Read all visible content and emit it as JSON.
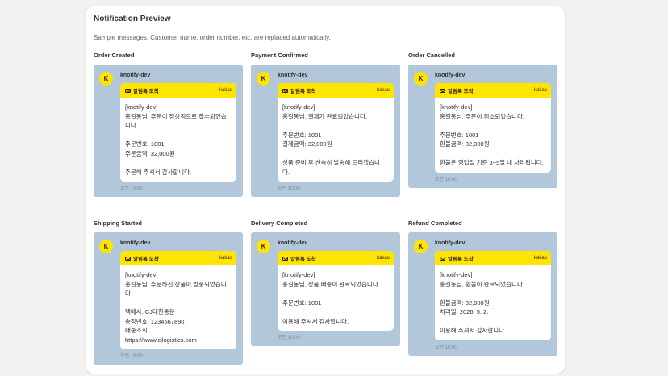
{
  "preview": {
    "title": "Notification Preview",
    "description": "Sample messages. Customer name, order number, etc. are replaced automatically."
  },
  "colors": {
    "chat_bg": "#b2c7da",
    "kakao_yellow": "#fee500"
  },
  "cards": [
    {
      "label": "Order Created",
      "avatar": "K",
      "sender": "knotify-dev",
      "head": "알림톡 도착",
      "brand": "kakao",
      "lines": [
        "[knotify-dev]",
        "홍길동님, 주문이 정상적으로 접수되었습",
        "니다.",
        "",
        "주문번호: 1001",
        "주문금액: 32,000원",
        "",
        "주문해 주셔서 감사합니다."
      ],
      "time": "오전 10:00"
    },
    {
      "label": "Payment Confirmed",
      "avatar": "K",
      "sender": "knotify-dev",
      "head": "알림톡 도착",
      "brand": "kakao",
      "lines": [
        "[knotify-dev]",
        "홍길동님, 결제가 완료되었습니다.",
        "",
        "주문번호: 1001",
        "결제금액: 32,000원",
        "",
        "상품 준비 후 신속히 발송해 드리겠습니",
        "다."
      ],
      "time": "오전 10:00"
    },
    {
      "label": "Order Cancelled",
      "avatar": "K",
      "sender": "knotify-dev",
      "head": "알림톡 도착",
      "brand": "kakao",
      "lines": [
        "[knotify-dev]",
        "홍길동님, 주문이 취소되었습니다.",
        "",
        "주문번호: 1001",
        "환불금액: 32,000원",
        "",
        "환불은 영업일 기준 3~5일 내 처리됩니다."
      ],
      "time": "오전 10:00"
    },
    {
      "label": "Shipping Started",
      "avatar": "K",
      "sender": "knotify-dev",
      "head": "알림톡 도착",
      "brand": "kakao",
      "lines": [
        "[knotify-dev]",
        "홍길동님, 주문하신 상품이 발송되었습니",
        "다.",
        "",
        "택배사: CJ대한통운",
        "송장번호: 1234567890",
        "배송조회:",
        "https://www.cjlogistics.com"
      ],
      "time": "오전 10:00"
    },
    {
      "label": "Delivery Completed",
      "avatar": "K",
      "sender": "knotify-dev",
      "head": "알림톡 도착",
      "brand": "kakao",
      "lines": [
        "[knotify-dev]",
        "홍길동님, 상품 배송이 완료되었습니다.",
        "",
        "주문번호: 1001",
        "",
        "이용해 주셔서 감사합니다."
      ],
      "time": "오전 10:00"
    },
    {
      "label": "Refund Completed",
      "avatar": "K",
      "sender": "knotify-dev",
      "head": "알림톡 도착",
      "brand": "kakao",
      "lines": [
        "[knotify-dev]",
        "홍길동님, 환불이 완료되었습니다.",
        "",
        "환불금액: 32,000원",
        "처리일: 2026. 5. 2.",
        "",
        "이용해 주셔서 감사합니다."
      ],
      "time": "오전 10:00"
    }
  ]
}
